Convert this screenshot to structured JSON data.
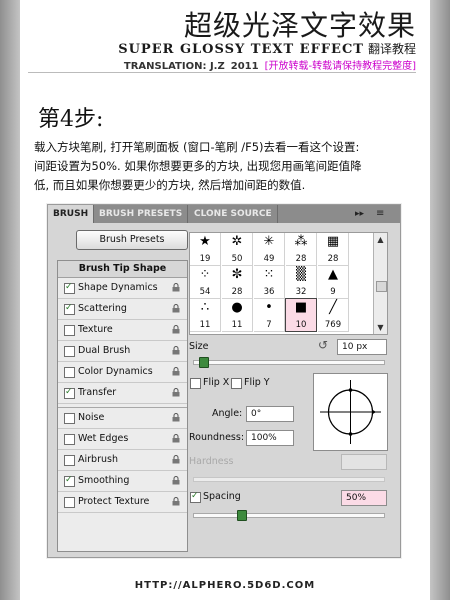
{
  "header": {
    "title": "超级光泽文字效果",
    "subtitle": "SUPER GLOSSY TEXT EFFECT",
    "subtitle_cn": "翻译教程",
    "translation": "TRANSLATION: J.Z",
    "year": "2011",
    "notice": "[开放转载-转载请保持教程完整度]"
  },
  "step": {
    "heading": "第4步:",
    "line1": "载入方块笔刷, 打开笔刷面板 (窗口-笔刷 /F5)去看一看这个设置:",
    "line2": "间距设置为50%. 如果你想要更多的方块, 出现您用画笔间距值降",
    "line3": "低, 而且如果你想要更少的方块, 然后增加间距的数值."
  },
  "panel": {
    "tabs": [
      "BRUSH",
      "BRUSH PRESETS",
      "CLONE SOURCE"
    ],
    "tab_controls": "▸▸",
    "menu_icon": "≡",
    "brush_presets_button": "Brush Presets",
    "options_header": "Brush Tip Shape",
    "options": [
      {
        "label": "Shape Dynamics",
        "checked": true
      },
      {
        "label": "Scattering",
        "checked": true
      },
      {
        "label": "Texture",
        "checked": false
      },
      {
        "label": "Dual Brush",
        "checked": false
      },
      {
        "label": "Color Dynamics",
        "checked": false
      },
      {
        "label": "Transfer",
        "checked": true
      },
      {
        "label": "Noise",
        "checked": false
      },
      {
        "label": "Wet Edges",
        "checked": false
      },
      {
        "label": "Airbrush",
        "checked": false
      },
      {
        "label": "Smoothing",
        "checked": true
      },
      {
        "label": "Protect Texture",
        "checked": false
      }
    ],
    "brushes": [
      {
        "icon": "★",
        "size": "19"
      },
      {
        "icon": "✲",
        "size": "50"
      },
      {
        "icon": "✳",
        "size": "49"
      },
      {
        "icon": "⁂",
        "size": "28"
      },
      {
        "icon": "▦",
        "size": "28"
      },
      {
        "icon": "⁘",
        "size": "54"
      },
      {
        "icon": "✼",
        "size": "28"
      },
      {
        "icon": "⁙",
        "size": "36"
      },
      {
        "icon": "▒",
        "size": "32"
      },
      {
        "icon": "▲",
        "size": "9"
      },
      {
        "icon": "∴",
        "size": "11"
      },
      {
        "icon": "●",
        "size": "11"
      },
      {
        "icon": "•",
        "size": "7"
      },
      {
        "icon": "■",
        "size": "10",
        "selected": true
      },
      {
        "icon": "╱",
        "size": "769"
      }
    ],
    "size_label": "Size",
    "size_value": "10 px",
    "reset_icon": "↺",
    "flip_x": "Flip X",
    "flip_y": "Flip Y",
    "angle_label": "Angle:",
    "angle_value": "0°",
    "roundness_label": "Roundness:",
    "roundness_value": "100%",
    "hardness_label": "Hardness",
    "spacing_label": "Spacing",
    "spacing_value": "50%",
    "spacing_checked": true,
    "size_slider_pct": 5,
    "spacing_slider_pct": 25,
    "colors": {
      "accent_check": "#2a7a2a",
      "selected_cell": "#fbdbe6",
      "notice": "#cc00cc"
    }
  },
  "footer": {
    "url": "HTTP://ALPHERO.5D6D.COM"
  }
}
